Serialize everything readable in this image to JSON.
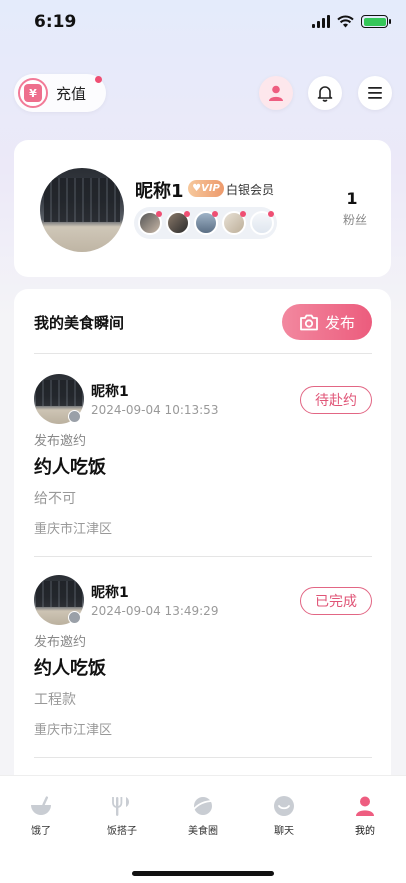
{
  "status_bar": {
    "time": "6:19"
  },
  "topbar": {
    "recharge_label": "充值"
  },
  "profile": {
    "nickname": "昵称1",
    "vip_badge": "VIP",
    "vip_level": "白银会员",
    "fans_count": "1",
    "fans_label": "粉丝"
  },
  "moments": {
    "title": "我的美食瞬间",
    "publish_label": "发布",
    "posts": [
      {
        "name": "昵称1",
        "time": "2024-09-04 10:13:53",
        "status": "待赴约",
        "type": "发布邀约",
        "title": "约人吃饭",
        "desc": "给不可",
        "location": "重庆市江津区"
      },
      {
        "name": "昵称1",
        "time": "2024-09-04 13:49:29",
        "status": "已完成",
        "type": "发布邀约",
        "title": "约人吃饭",
        "desc": "工程款",
        "location": "重庆市江津区"
      }
    ]
  },
  "tabbar": {
    "items": [
      {
        "label": "饿了",
        "icon": "bowl-icon"
      },
      {
        "label": "饭搭子",
        "icon": "fork-knife-icon"
      },
      {
        "label": "美食圈",
        "icon": "planet-icon"
      },
      {
        "label": "聊天",
        "icon": "chat-icon"
      },
      {
        "label": "我的",
        "icon": "person-icon"
      }
    ]
  },
  "colors": {
    "accent": "#ec5c7d",
    "vip": "#ed9a6c"
  }
}
